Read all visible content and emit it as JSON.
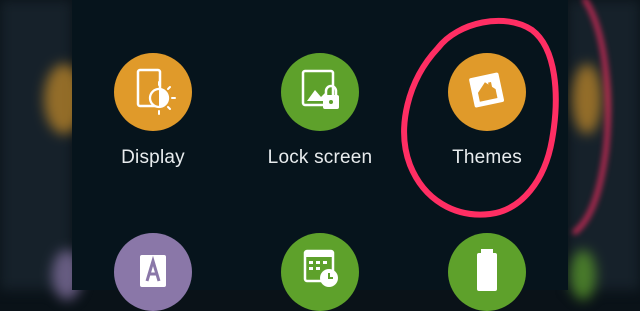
{
  "colors": {
    "orange": "#e09a2a",
    "green": "#5ea12b",
    "purple": "#8a77a8",
    "annotation": "#ff2e63"
  },
  "settings": {
    "items": [
      {
        "label": "Display",
        "icon": "display-icon",
        "color": "#e09a2a"
      },
      {
        "label": "Lock screen",
        "icon": "lock-screen-icon",
        "color": "#5ea12b"
      },
      {
        "label": "Themes",
        "icon": "themes-icon",
        "color": "#e09a2a"
      },
      {
        "label": "",
        "icon": "font-icon",
        "color": "#8a77a8"
      },
      {
        "label": "",
        "icon": "calendar-clock-icon",
        "color": "#5ea12b"
      },
      {
        "label": "",
        "icon": "battery-icon",
        "color": "#5ea12b"
      }
    ]
  }
}
